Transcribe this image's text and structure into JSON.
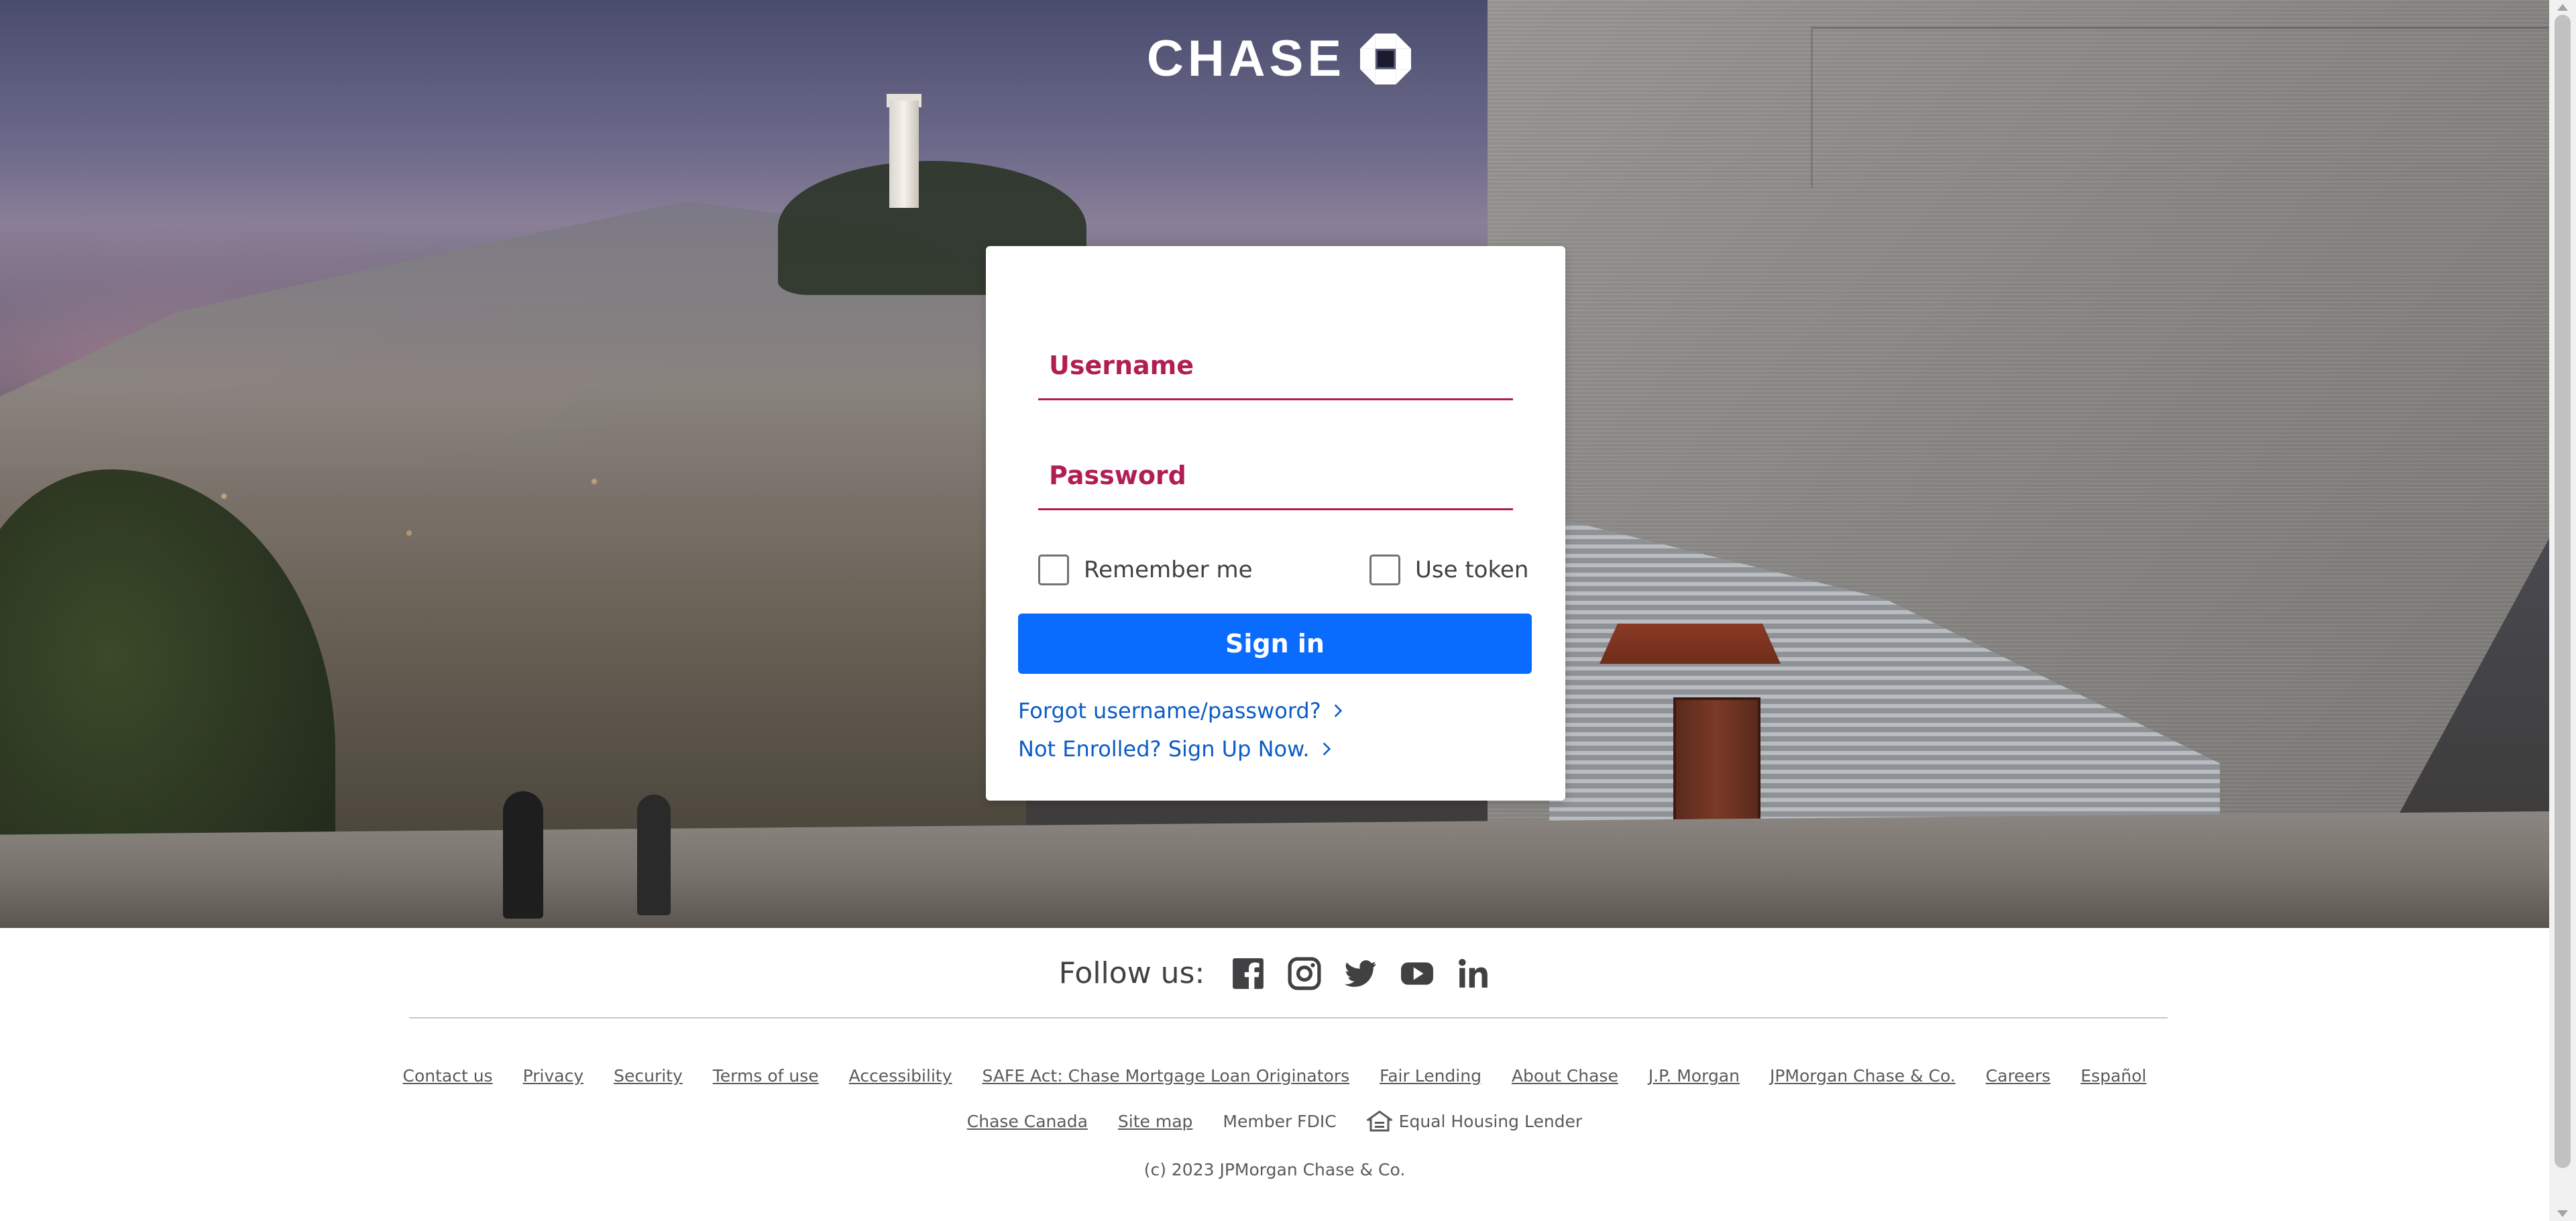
{
  "brand": {
    "logo_text": "CHASE",
    "logo_icon": "chase-octagon-icon",
    "primary_color": "#0a6cff",
    "field_color": "#b11e54"
  },
  "login": {
    "username_placeholder": "Username",
    "password_placeholder": "Password",
    "remember_label": "Remember me",
    "token_label": "Use token",
    "signin_label": "Sign in",
    "forgot_link": "Forgot username/password?",
    "enroll_link": "Not Enrolled? Sign Up Now."
  },
  "footer": {
    "follow_label": "Follow us:",
    "social_icons": [
      "facebook-icon",
      "instagram-icon",
      "twitter-icon",
      "youtube-icon",
      "linkedin-icon"
    ],
    "links_row1": [
      "Contact us",
      "Privacy",
      "Security",
      "Terms of use",
      "Accessibility",
      "SAFE Act: Chase Mortgage Loan Originators",
      "Fair Lending",
      "About Chase",
      "J.P. Morgan",
      "JPMorgan Chase & Co.",
      "Careers",
      "Español"
    ],
    "links_row2": [
      "Chase Canada",
      "Site map"
    ],
    "member_fdic": "Member FDIC",
    "equal_housing": "Equal Housing Lender",
    "copyright": "(c) 2023 JPMorgan Chase & Co."
  }
}
